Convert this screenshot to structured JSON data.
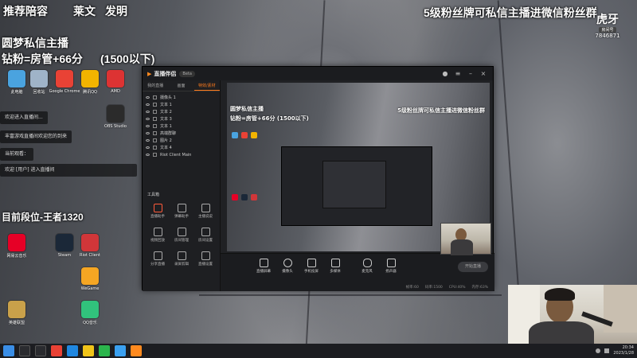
{
  "overlays": {
    "top_left_1": "推荐陪容",
    "top_left_2": "莱文",
    "top_left_3": "发明",
    "left_line1": "圆梦私信主播",
    "left_line2": "钻粉=房管+66分",
    "left_line3": "(1500以下)",
    "top_right": "5级粉丝牌可私信主播进微信粉丝群",
    "rank_line": "目前段位-王者1320",
    "chat": [
      "欢迎进入直播间...",
      "丰富游戏直播间欢迎您的到来",
      "当前观看：",
      "欢迎 [用户] 进入直播间"
    ]
  },
  "huya": {
    "logo": "虎牙",
    "badge": "房间号",
    "room": "7846871"
  },
  "desktop_icons": [
    {
      "label": "此电脑",
      "color": "#4aa3df"
    },
    {
      "label": "回收站",
      "color": "#9fb3c8"
    },
    {
      "label": "Google Chrome",
      "color": "#e94235"
    },
    {
      "label": "腾讯QQ",
      "color": "#f2b400"
    },
    {
      "label": "AMD",
      "color": "#d33"
    },
    {
      "label": "OBS Studio",
      "color": "#2b2b2b"
    },
    {
      "label": "网易云音乐",
      "color": "#e60026"
    },
    {
      "label": "Steam",
      "color": "#1b2838"
    },
    {
      "label": "Riot Client",
      "color": "#d13639"
    },
    {
      "label": "WeGame",
      "color": "#f5a623"
    },
    {
      "label": "英雄联盟",
      "color": "#c9a14a"
    },
    {
      "label": "QQ音乐",
      "color": "#31c27c"
    }
  ],
  "app": {
    "title": "直播伴侣",
    "version": "Beta",
    "tabs": [
      "我的直播",
      "画面",
      "特效/素材"
    ],
    "sources": [
      "摄像头 1",
      "文本 1",
      "文本 2",
      "文本 3",
      "文本 1",
      "高端群聊",
      "图片 2",
      "文本 4",
      "Riot Client Main"
    ],
    "toolbox_title": "工具箱",
    "tools": [
      "直播助手",
      "弹幕助手",
      "主播说说",
      "视频回放",
      "房间管理",
      "房间设置",
      "分享直播",
      "录屏剪辑",
      "直播设置"
    ],
    "bottom_buttons": [
      "直播屏幕",
      "摄像头",
      "手机投屏",
      "多媒体",
      "麦克风",
      "扬声器"
    ],
    "start_button": "开始直播",
    "status": [
      "帧率:60",
      "码率:1500",
      "CPU:40%",
      "内存:63%"
    ],
    "preview_text1": "5级粉丝牌可私信主播进微信粉丝群",
    "preview_text2": "圆梦私信主播",
    "preview_text3": "钻粉=房管+66分 (1500以下)"
  },
  "taskbar": {
    "time": "20:34",
    "date": "2023/1/28"
  }
}
